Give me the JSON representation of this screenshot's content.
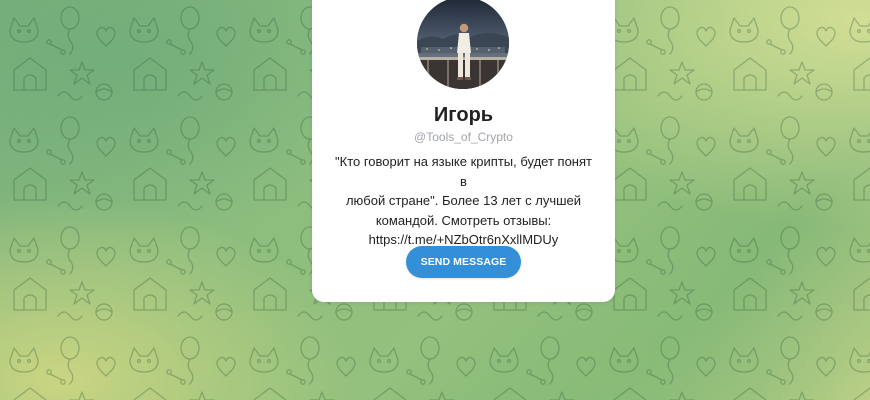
{
  "profile": {
    "name": "Игорь",
    "username": "@Tools_of_Crypto",
    "bio": "\"Кто говорит на языке крипты, будет понят в\nлюбой стране\". Более 13 лет с лучшей\nкомандой. Смотреть отзывы:\nhttps://t.me/+NZbOtr6nXxllMDUy"
  },
  "actions": {
    "send_message_label": "SEND MESSAGE"
  },
  "colors": {
    "accent": "#3390d8",
    "card": "#ffffff",
    "background_green": "#8fbf7a",
    "background_yellow": "#cfd98c"
  }
}
